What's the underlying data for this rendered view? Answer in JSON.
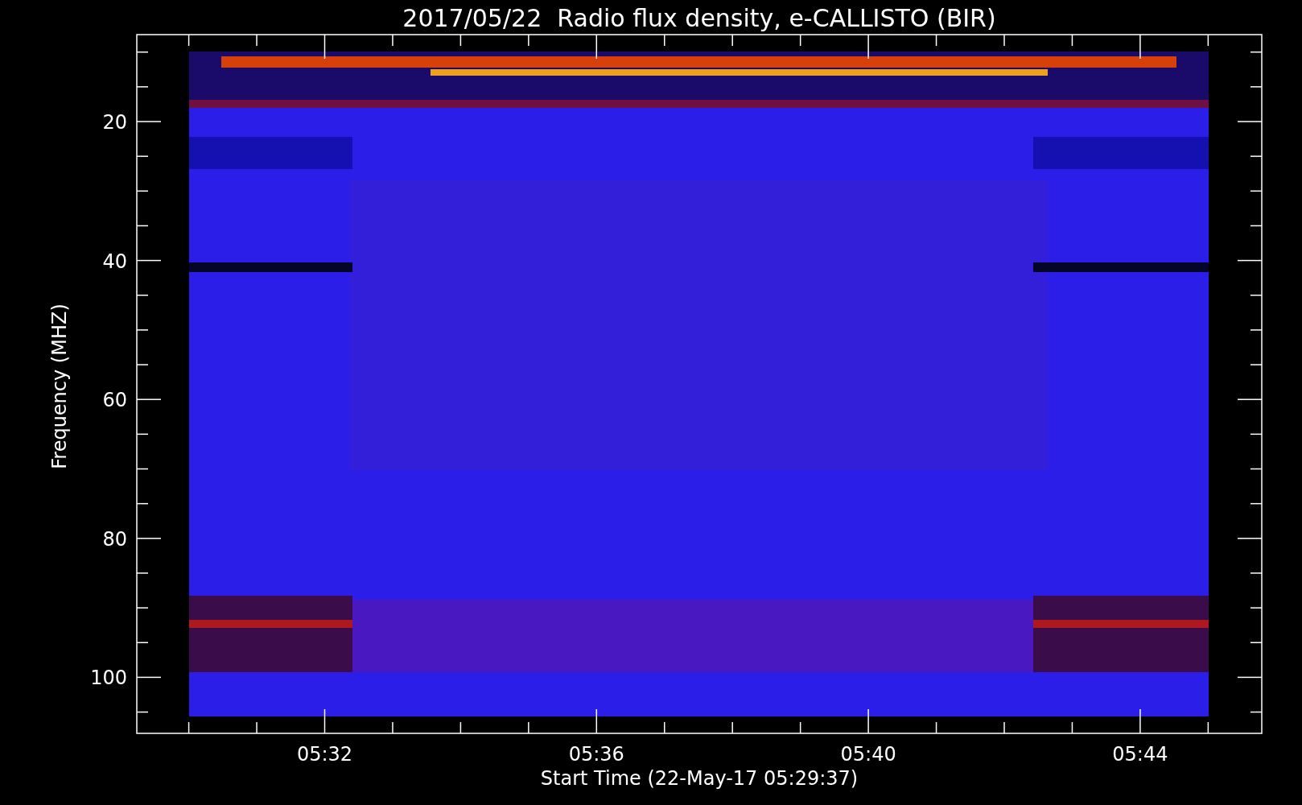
{
  "title": "2017/05/22  Radio flux density, e-CALLISTO (BIR)",
  "spectrogram": {
    "kind": "spectrogram",
    "y_axis": {
      "label": "Frequency (MHZ)",
      "tick_labels": [
        "20",
        "40",
        "60",
        "80",
        "100"
      ]
    },
    "x_axis": {
      "label": "Start Time (22-May-17 05:29:37)",
      "tick_labels": [
        "05:32",
        "05:36",
        "05:40",
        "05:44"
      ]
    }
  }
}
